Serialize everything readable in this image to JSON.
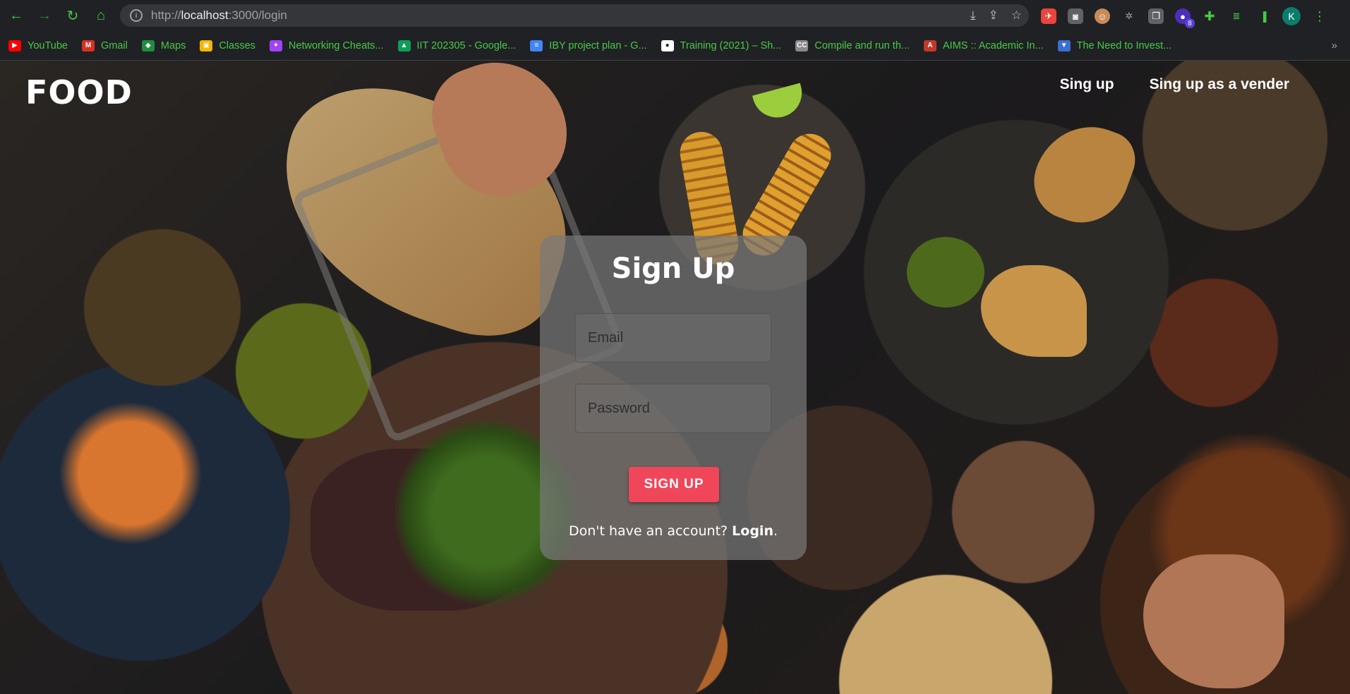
{
  "browser": {
    "url_host": "localhost",
    "url_prefix": "http://",
    "url_rest": ":3000/login",
    "profile_initial": "K",
    "extension_badge": "8",
    "bookmarks": [
      {
        "label": "YouTube",
        "color": "#ff0000",
        "glyph": "▶"
      },
      {
        "label": "Gmail",
        "color": "#d93025",
        "glyph": "M"
      },
      {
        "label": "Maps",
        "color": "#1e8e3e",
        "glyph": "◆"
      },
      {
        "label": "Classes",
        "color": "#f4b400",
        "glyph": "▣"
      },
      {
        "label": "Networking Cheats...",
        "color": "#a142f4",
        "glyph": "✦"
      },
      {
        "label": "IIT 202305 - Google...",
        "color": "#0f9d58",
        "glyph": "▲"
      },
      {
        "label": "IBY project plan - G...",
        "color": "#4285f4",
        "glyph": "≡"
      },
      {
        "label": "Training (2021) – Sh...",
        "color": "#ffffff",
        "glyph": "●"
      },
      {
        "label": "Compile and run th...",
        "color": "#8a8a8a",
        "glyph": "CC"
      },
      {
        "label": "AIMS :: Academic In...",
        "color": "#c0392b",
        "glyph": "A"
      },
      {
        "label": "The Need to Invest...",
        "color": "#3b6fd1",
        "glyph": "▼"
      }
    ],
    "more_bookmarks": "»"
  },
  "site": {
    "logo": "FOOD",
    "nav": {
      "signup": "Sing up",
      "signup_vendor": "Sing up as a vender"
    }
  },
  "form": {
    "title": "Sign Up",
    "email_placeholder": "Email",
    "password_placeholder": "Password",
    "submit_label": "SIGN UP",
    "footer_text": "Don't have an account? ",
    "footer_link": "Login",
    "footer_end": "."
  },
  "colors": {
    "accent": "#f0465a",
    "chrome_bg": "#202124",
    "bookmark_text": "#47c947"
  }
}
